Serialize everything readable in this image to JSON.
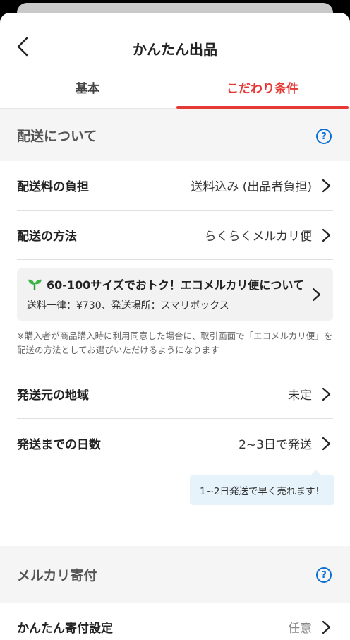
{
  "header": {
    "title": "かんたん出品"
  },
  "tabs": [
    {
      "label": "基本",
      "active": false
    },
    {
      "label": "こだわり条件",
      "active": true
    }
  ],
  "shipping_section": {
    "title": "配送について",
    "help_icon": "?",
    "rows": [
      {
        "label": "配送料の負担",
        "value": "送料込み (出品者負担)"
      },
      {
        "label": "配送の方法",
        "value": "らくらくメルカリ便"
      }
    ],
    "promo": {
      "icon": "sprout-icon",
      "title": "60-100サイズでおトク！エコメルカリ便について",
      "subtitle": "送料一律：¥730、発送場所：スマリボックス"
    },
    "note": "※購入者が商品購入時に利用同意した場合に、取引画面で「エコメルカリ便」を配送の方法としてお選びいただけるようになります",
    "rows2": [
      {
        "label": "発送元の地域",
        "value": "未定"
      },
      {
        "label": "発送までの日数",
        "value": "2~3日で発送"
      }
    ],
    "tooltip": "1~2日発送で早く売れます！"
  },
  "donation_section": {
    "title": "メルカリ寄付",
    "help_icon": "?",
    "row": {
      "label": "かんたん寄付設定",
      "value": "任意"
    }
  },
  "colors": {
    "accent": "#e53935",
    "link": "#0a6fd6",
    "tooltip_bg": "#e6f3fb"
  }
}
